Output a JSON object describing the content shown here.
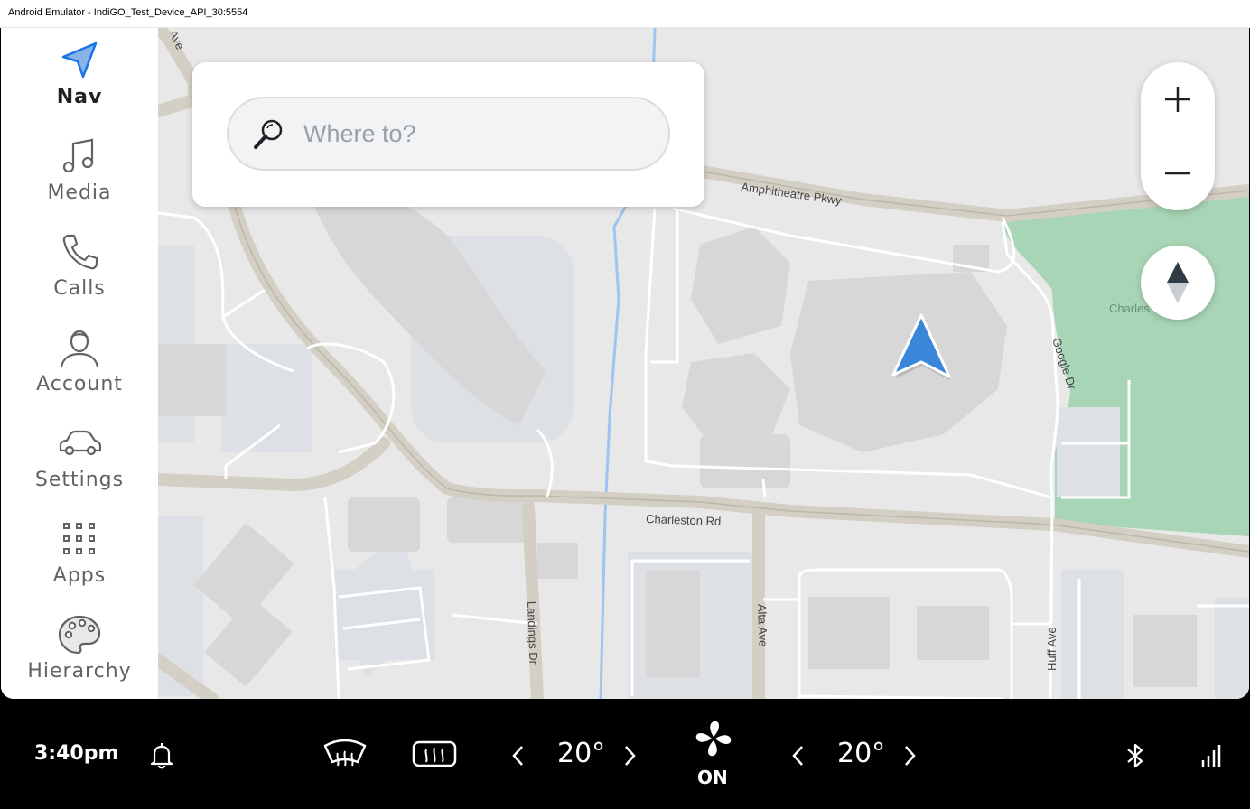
{
  "window": {
    "title": "Android Emulator - IndiGO_Test_Device_API_30:5554"
  },
  "rail": {
    "items": [
      {
        "label": "Nav",
        "icon": "navigation-arrow-icon",
        "active": true
      },
      {
        "label": "Media",
        "icon": "music-note-icon"
      },
      {
        "label": "Calls",
        "icon": "phone-icon"
      },
      {
        "label": "Account",
        "icon": "person-icon"
      },
      {
        "label": "Settings",
        "icon": "car-icon"
      },
      {
        "label": "Apps",
        "icon": "apps-grid-icon"
      },
      {
        "label": "Hierarchy",
        "icon": "palette-icon"
      }
    ]
  },
  "search": {
    "placeholder": "Where to?",
    "icon": "search-icon"
  },
  "map": {
    "street_labels": [
      "Amphitheatre Pkwy",
      "Charleston Rd",
      "Google Dr",
      "Landings Dr",
      "Alta Ave",
      "Huff Ave",
      "Charles",
      "Ave"
    ],
    "controls": {
      "zoom_in": "zoom-in-icon",
      "zoom_out": "zoom-out-icon",
      "compass": "compass-icon"
    },
    "colors": {
      "land": "#e8e8e8",
      "park": "#a8d5b5",
      "road_major": "#d4cfc4",
      "road_minor": "#ffffff",
      "water": "#9ec4f0",
      "building": "#d9d9d9",
      "parking": "#dde1e6",
      "location_arrow": "#3a86d9"
    }
  },
  "facility_bar": {
    "time": "3:40pm",
    "left_temp": "20°",
    "right_temp": "20°",
    "fan_state": "ON",
    "icons": [
      "notification-bell-icon",
      "front-defrost-icon",
      "rear-defrost-icon",
      "chevron-left-icon",
      "chevron-right-icon",
      "fan-icon",
      "bluetooth-icon",
      "signal-icon"
    ]
  }
}
